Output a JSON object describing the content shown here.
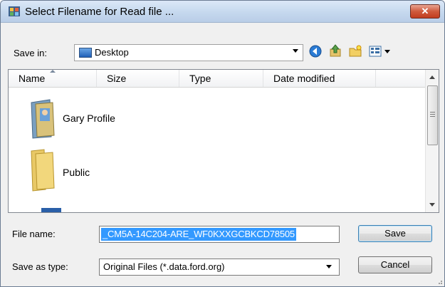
{
  "window": {
    "title": "Select Filename for Read file ..."
  },
  "toolbar": {
    "save_in_label": "Save in:",
    "save_in_value": "Desktop"
  },
  "file_list": {
    "columns": [
      "Name",
      "Size",
      "Type",
      "Date modified"
    ],
    "items": [
      {
        "name": "Gary Profile",
        "icon": "user-folder-icon"
      },
      {
        "name": "Public",
        "icon": "folder-icon"
      }
    ]
  },
  "footer": {
    "file_name_label": "File name:",
    "file_name_value": "_CM5A-14C204-ARE_WF0KXXGCBKCD78505",
    "save_as_type_label": "Save as type:",
    "save_as_type_value": "Original Files (*.data.ford.org)",
    "save_button": "Save",
    "cancel_button": "Cancel"
  },
  "colors": {
    "selection": "#3399ff",
    "titlebar": "#c5d8ee",
    "close_button": "#cf5a3c"
  }
}
